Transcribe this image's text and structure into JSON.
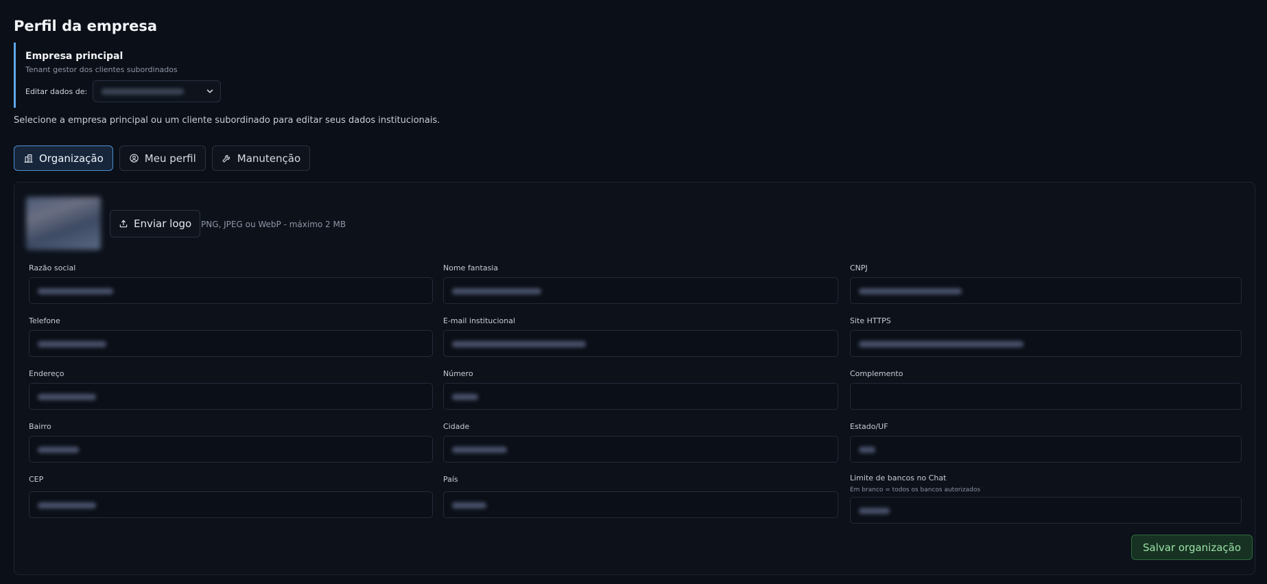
{
  "page": {
    "title": "Perfil da empresa",
    "hint": "Selecione a empresa principal ou um cliente subordinado para editar seus dados institucionais."
  },
  "tenant": {
    "title": "Empresa principal",
    "subtitle": "Tenant gestor dos clientes subordinados",
    "edit_label": "Editar dados de:",
    "select_value": ""
  },
  "tabs": [
    {
      "label": "Organização",
      "icon": "building-icon",
      "active": true
    },
    {
      "label": "Meu perfil",
      "icon": "user-circle-icon",
      "active": false
    },
    {
      "label": "Manutenção",
      "icon": "wrench-icon",
      "active": false
    }
  ],
  "logo": {
    "upload_label": "Enviar logo",
    "hint": "PNG, JPEG ou WebP - máximo 2 MB"
  },
  "fields": [
    {
      "label": "Razão social"
    },
    {
      "label": "Nome fantasia"
    },
    {
      "label": "CNPJ"
    },
    {
      "label": "Telefone"
    },
    {
      "label": "E-mail institucional"
    },
    {
      "label": "Site HTTPS"
    },
    {
      "label": "Endereço"
    },
    {
      "label": "Número"
    },
    {
      "label": "Complemento"
    },
    {
      "label": "Bairro"
    },
    {
      "label": "Cidade"
    },
    {
      "label": "Estado/UF"
    },
    {
      "label": "CEP"
    },
    {
      "label": "País"
    },
    {
      "label": "Limite de bancos no Chat",
      "sub": "Em branco = todos os bancos autorizados"
    }
  ],
  "actions": {
    "save_label": "Salvar organização"
  },
  "colors": {
    "accent": "#5fa8ea",
    "save": "#9be2a8",
    "background": "#0b0f17"
  }
}
